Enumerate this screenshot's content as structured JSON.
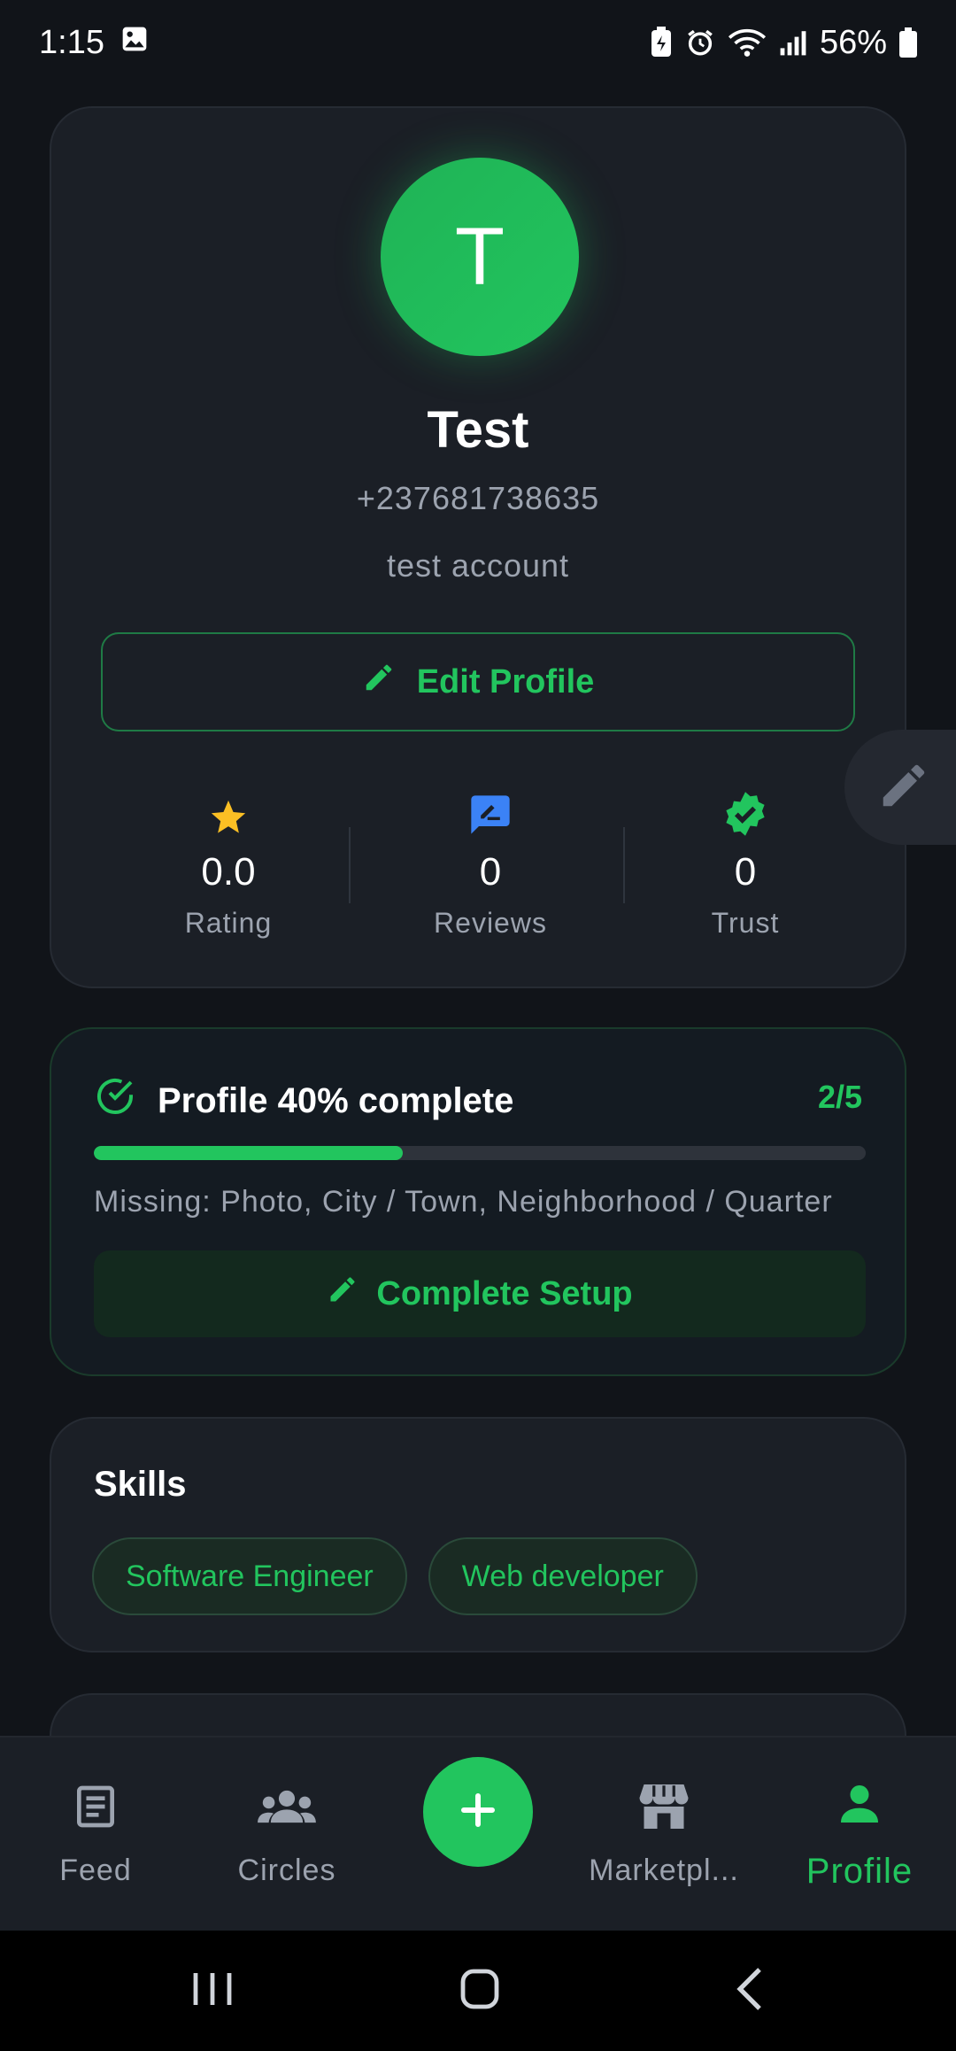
{
  "status_bar": {
    "time": "1:15",
    "battery": "56%"
  },
  "profile": {
    "avatar_initial": "T",
    "name": "Test",
    "phone": "+237681738635",
    "bio": "test account",
    "edit_label": "Edit Profile"
  },
  "stats": [
    {
      "value": "0.0",
      "label": "Rating",
      "icon": "star-icon",
      "color": "#fbbf24"
    },
    {
      "value": "0",
      "label": "Reviews",
      "icon": "review-icon",
      "color": "#3b82f6"
    },
    {
      "value": "0",
      "label": "Trust",
      "icon": "verified-icon",
      "color": "#22c55e"
    }
  ],
  "completion": {
    "title": "Profile 40% complete",
    "count": "2/5",
    "progress": 0.4,
    "missing": "Missing: Photo, City / Town, Neighborhood / Quarter",
    "button_label": "Complete Setup"
  },
  "skills": {
    "title": "Skills",
    "items": [
      "Software Engineer",
      "Web developer"
    ]
  },
  "bottom_nav": {
    "feed": "Feed",
    "circles": "Circles",
    "marketplace": "Marketpl...",
    "profile": "Profile"
  },
  "colors": {
    "accent": "#22c55e",
    "background": "#111419",
    "card": "#1b1f26"
  }
}
